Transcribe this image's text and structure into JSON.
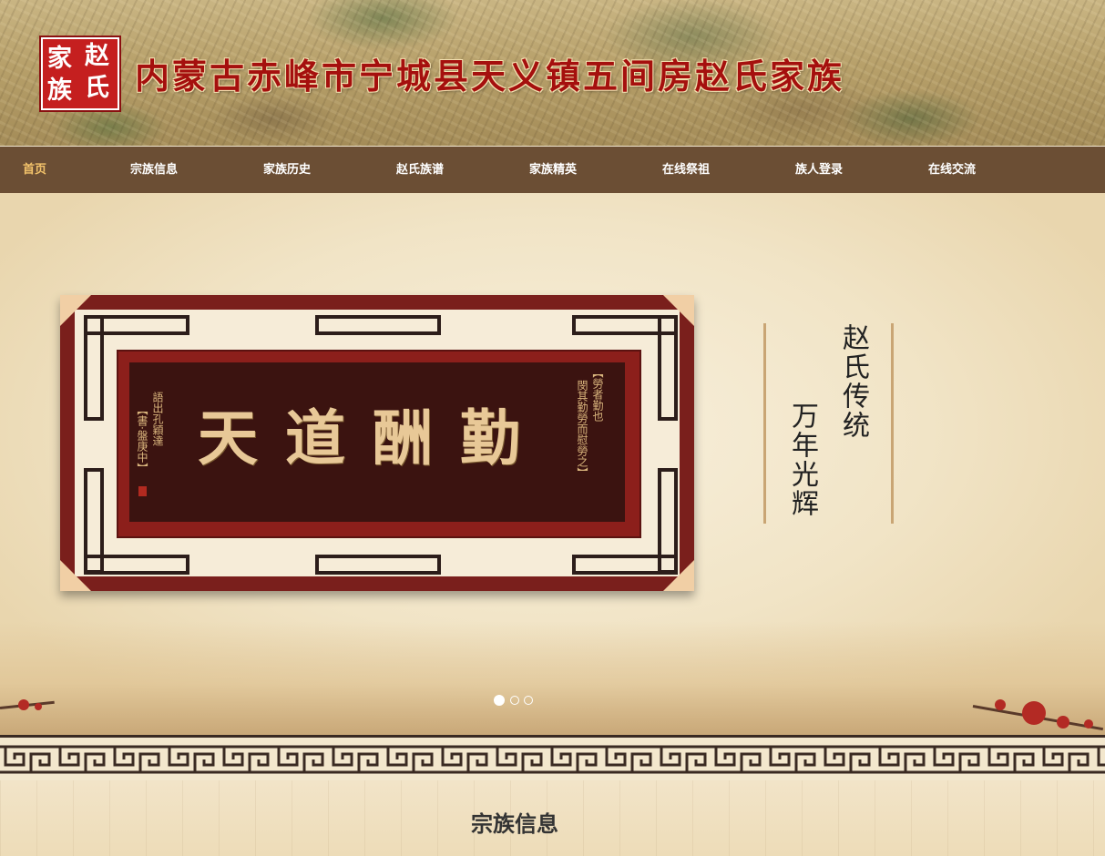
{
  "header": {
    "logo_chars": [
      "赵",
      "氏",
      "家",
      "族"
    ],
    "site_title": "内蒙古赤峰市宁城县天义镇五间房赵氏家族"
  },
  "nav": {
    "items": [
      {
        "label": "首页",
        "active": true
      },
      {
        "label": "宗族信息"
      },
      {
        "label": "家族历史"
      },
      {
        "label": "赵氏族谱"
      },
      {
        "label": "家族精英"
      },
      {
        "label": "在线祭祖"
      },
      {
        "label": "族人登录"
      },
      {
        "label": "在线交流"
      }
    ],
    "active_color": "#f3c36b"
  },
  "banner": {
    "plaque": {
      "main_text": "天道酬勤",
      "right_lines": [
        "【勞者勤也",
        "閔其勤勞而慰勞之】"
      ],
      "left_lines": [
        "語出孔穎達",
        "【書·盤庚中】"
      ]
    },
    "motto": [
      "赵氏传统",
      "万年光辉"
    ],
    "slides": {
      "count": 3,
      "active_index": 0
    }
  },
  "section": {
    "title": "宗族信息"
  },
  "colors": {
    "nav_bg": "#6b4e34",
    "title_red": "#a5100e",
    "logo_red": "#c51f1f"
  }
}
